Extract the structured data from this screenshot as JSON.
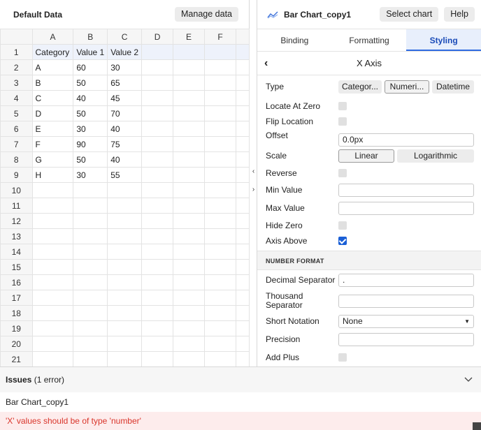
{
  "left": {
    "title": "Default Data",
    "manage_label": "Manage data",
    "columns": [
      "A",
      "B",
      "C",
      "D",
      "E",
      "F"
    ],
    "rows": [
      {
        "num": "1",
        "cells": [
          "Category",
          "Value 1",
          "Value 2",
          "",
          "",
          ""
        ]
      },
      {
        "num": "2",
        "cells": [
          "A",
          "60",
          "30",
          "",
          "",
          ""
        ]
      },
      {
        "num": "3",
        "cells": [
          "B",
          "50",
          "65",
          "",
          "",
          ""
        ]
      },
      {
        "num": "4",
        "cells": [
          "C",
          "40",
          "45",
          "",
          "",
          ""
        ]
      },
      {
        "num": "5",
        "cells": [
          "D",
          "50",
          "70",
          "",
          "",
          ""
        ]
      },
      {
        "num": "6",
        "cells": [
          "E",
          "30",
          "40",
          "",
          "",
          ""
        ]
      },
      {
        "num": "7",
        "cells": [
          "F",
          "90",
          "75",
          "",
          "",
          ""
        ]
      },
      {
        "num": "8",
        "cells": [
          "G",
          "50",
          "40",
          "",
          "",
          ""
        ]
      },
      {
        "num": "9",
        "cells": [
          "H",
          "30",
          "55",
          "",
          "",
          ""
        ]
      },
      {
        "num": "10",
        "cells": [
          "",
          "",
          "",
          "",
          "",
          ""
        ]
      },
      {
        "num": "11",
        "cells": [
          "",
          "",
          "",
          "",
          "",
          ""
        ]
      },
      {
        "num": "12",
        "cells": [
          "",
          "",
          "",
          "",
          "",
          ""
        ]
      },
      {
        "num": "13",
        "cells": [
          "",
          "",
          "",
          "",
          "",
          ""
        ]
      },
      {
        "num": "14",
        "cells": [
          "",
          "",
          "",
          "",
          "",
          ""
        ]
      },
      {
        "num": "15",
        "cells": [
          "",
          "",
          "",
          "",
          "",
          ""
        ]
      },
      {
        "num": "16",
        "cells": [
          "",
          "",
          "",
          "",
          "",
          ""
        ]
      },
      {
        "num": "17",
        "cells": [
          "",
          "",
          "",
          "",
          "",
          ""
        ]
      },
      {
        "num": "18",
        "cells": [
          "",
          "",
          "",
          "",
          "",
          ""
        ]
      },
      {
        "num": "19",
        "cells": [
          "",
          "",
          "",
          "",
          "",
          ""
        ]
      },
      {
        "num": "20",
        "cells": [
          "",
          "",
          "",
          "",
          "",
          ""
        ]
      },
      {
        "num": "21",
        "cells": [
          "",
          "",
          "",
          "",
          "",
          ""
        ]
      }
    ]
  },
  "right": {
    "chart_title": "Bar Chart_copy1",
    "chart_icon": "chart-area-icon",
    "select_chart_label": "Select chart",
    "help_label": "Help",
    "tabs": [
      "Binding",
      "Formatting",
      "Styling"
    ],
    "active_tab": "Styling",
    "section_title": "X Axis",
    "type_label": "Type",
    "type_options": [
      "Categor...",
      "Numeri...",
      "Datetime"
    ],
    "type_selected": "Numeri...",
    "locate_at_zero_label": "Locate At Zero",
    "flip_location_label": "Flip Location",
    "offset_label": "Offset",
    "offset_value": "0.0px",
    "scale_label": "Scale",
    "scale_options": [
      "Linear",
      "Logarithmic"
    ],
    "scale_selected": "Linear",
    "reverse_label": "Reverse",
    "min_value_label": "Min Value",
    "min_value": "",
    "max_value_label": "Max Value",
    "max_value": "",
    "hide_zero_label": "Hide Zero",
    "axis_above_label": "Axis Above",
    "axis_above_checked": true,
    "number_format_head": "NUMBER FORMAT",
    "decimal_separator_label": "Decimal Separator",
    "decimal_separator_value": ".",
    "thousand_separator_label": "Thousand Separator",
    "thousand_separator_value": "",
    "short_notation_label": "Short Notation",
    "short_notation_value": "None",
    "precision_label": "Precision",
    "precision_value": "",
    "add_plus_label": "Add Plus"
  },
  "issues": {
    "title": "Issues",
    "count_text": "(1 error)",
    "chart_name": "Bar Chart_copy1",
    "error_text": "'X' values should be of type 'number'"
  },
  "colors": {
    "accent": "#2f6be0",
    "active_tab_bg": "#e8effc",
    "error_text": "#d9352b",
    "error_bg": "#fdecec",
    "checkbox_on": "#1a5fd6"
  }
}
